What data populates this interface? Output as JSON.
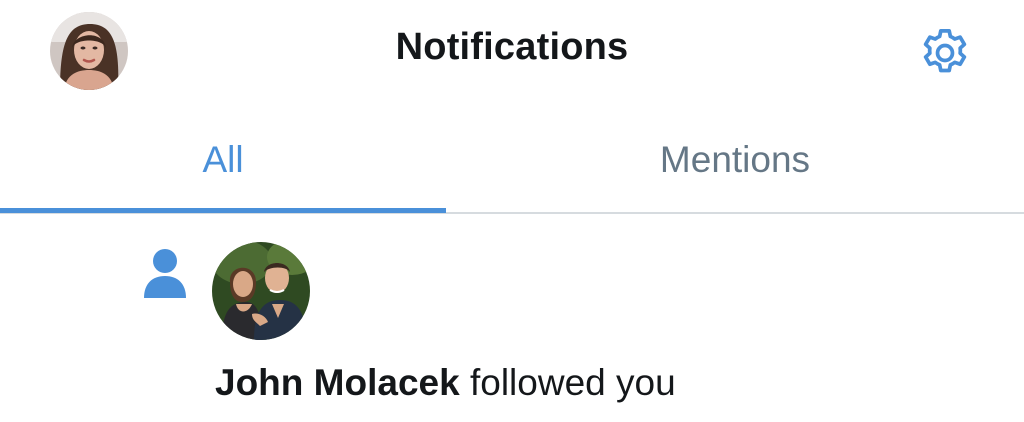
{
  "header": {
    "title": "Notifications",
    "profile_avatar": "profile-photo",
    "settings_icon": "gear-icon"
  },
  "tabs": [
    {
      "label": "All",
      "active": true
    },
    {
      "label": "Mentions",
      "active": false
    }
  ],
  "notifications": [
    {
      "type_icon": "person-icon",
      "user_name": "John Molacek",
      "action": " followed you",
      "avatar": "follower-photo"
    }
  ],
  "colors": {
    "accent": "#4a90d9",
    "text_primary": "#14171a",
    "text_secondary": "#657786",
    "divider": "#d6dbdf"
  }
}
